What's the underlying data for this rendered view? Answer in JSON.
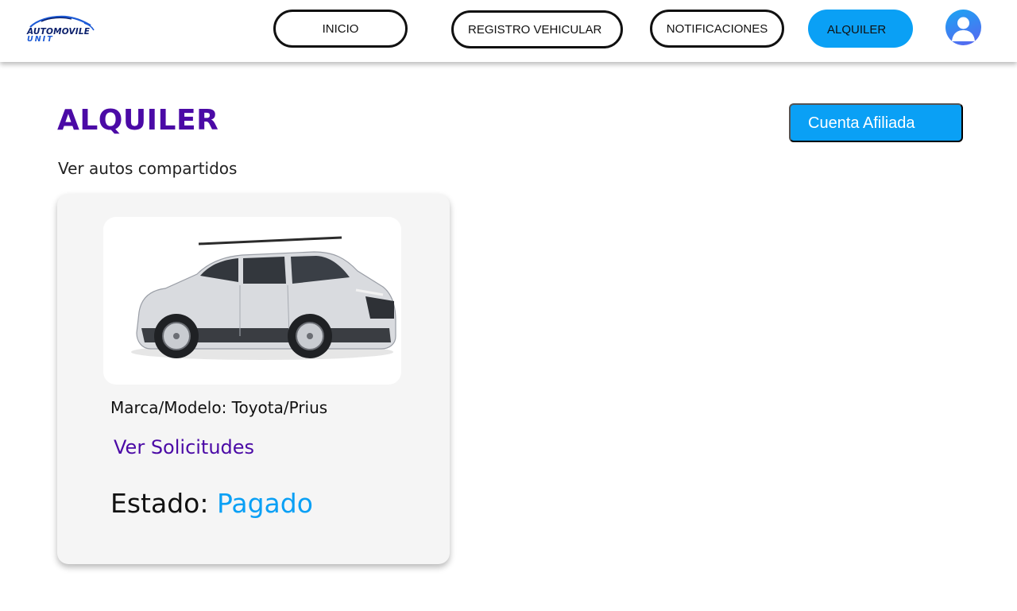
{
  "header": {
    "logo": {
      "line1": "AUTOMOVILE",
      "line2": "UNIT"
    },
    "nav": {
      "inicio": "INICIO",
      "registro": "REGISTRO VEHICULAR",
      "notificaciones": "NOTIFICACIONES",
      "alquiler": "ALQUILER"
    },
    "avatar_icon": "user-avatar-icon"
  },
  "main": {
    "title": "ALQUILER",
    "subtitle": "Ver autos compartidos",
    "account_button": "Cuenta Afiliada"
  },
  "card": {
    "image_icon": "car-photo",
    "brand_model": "Marca/Modelo: Toyota/Prius",
    "requests_link": "Ver Solicitudes",
    "status_label": "Estado:",
    "status_value": "Pagado"
  },
  "colors": {
    "primary_blue": "#0aa0f5",
    "accent_purple": "#4b0aa6",
    "card_bg": "#f5f5f5"
  }
}
